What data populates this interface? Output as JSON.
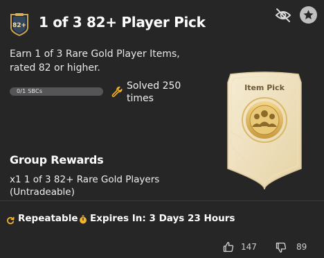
{
  "header": {
    "badge_number": "82+",
    "title": "1 of 3 82+ Player Pick"
  },
  "description": "Earn 1 of 3 Rare Gold Player Items, rated 82 or higher.",
  "progress": {
    "label": "0/1 SBCs",
    "fraction": 0
  },
  "solved": "Solved 250 times",
  "group_rewards": {
    "title": "Group Rewards",
    "text": "x1 1 of 3 82+ Rare Gold Players (Untradeable)"
  },
  "pack": {
    "label": "Item Pick"
  },
  "footer": {
    "repeatable": "Repeatable",
    "expires": "Expires In: 3 Days 23 Hours",
    "upvotes": "147",
    "downvotes": "89"
  },
  "colors": {
    "background": "#262627",
    "accent_gold": "#f2b32b",
    "progress_track": "#555558"
  },
  "icons": {
    "badge": "shield-badge-icon",
    "hide": "eye-off-icon",
    "favorite": "star-icon",
    "wrench": "wrench-icon",
    "repeat": "repeat-icon",
    "timer": "stopwatch-icon",
    "thumb_up": "thumb-up-icon",
    "thumb_down": "thumb-down-icon"
  }
}
